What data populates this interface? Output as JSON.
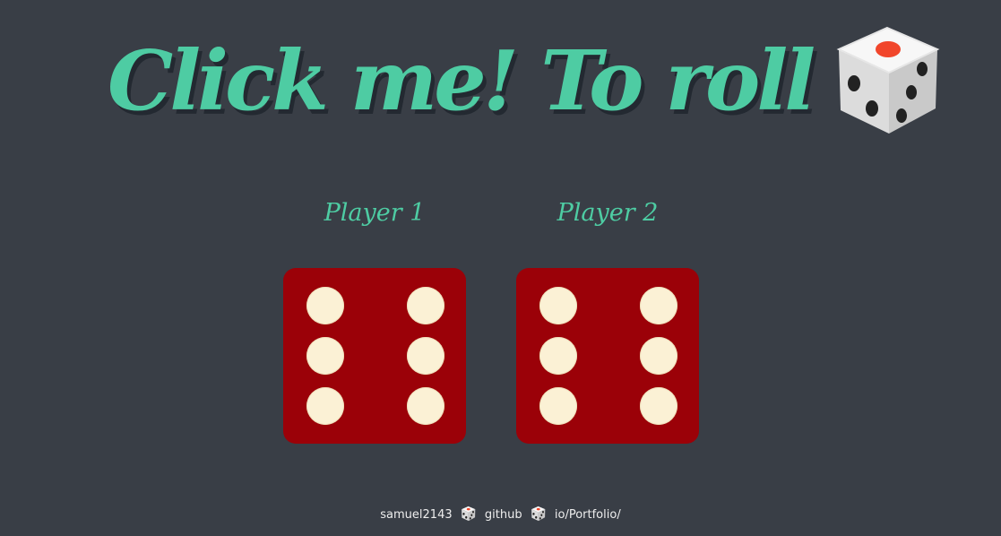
{
  "header": {
    "title": "Click me! To roll",
    "title_icon": "dice-icon"
  },
  "players": [
    {
      "label": "Player 1",
      "die_value": 6
    },
    {
      "label": "Player 2",
      "die_value": 6
    }
  ],
  "footer": {
    "part1": "samuel2143",
    "part2": "github",
    "part3": "io/Portfolio/",
    "separator_icon": "dice-icon"
  },
  "colors": {
    "background": "#393e46",
    "accent": "#4ecca3",
    "die_red": "#9b0108",
    "pip": "#fbf1d5"
  }
}
